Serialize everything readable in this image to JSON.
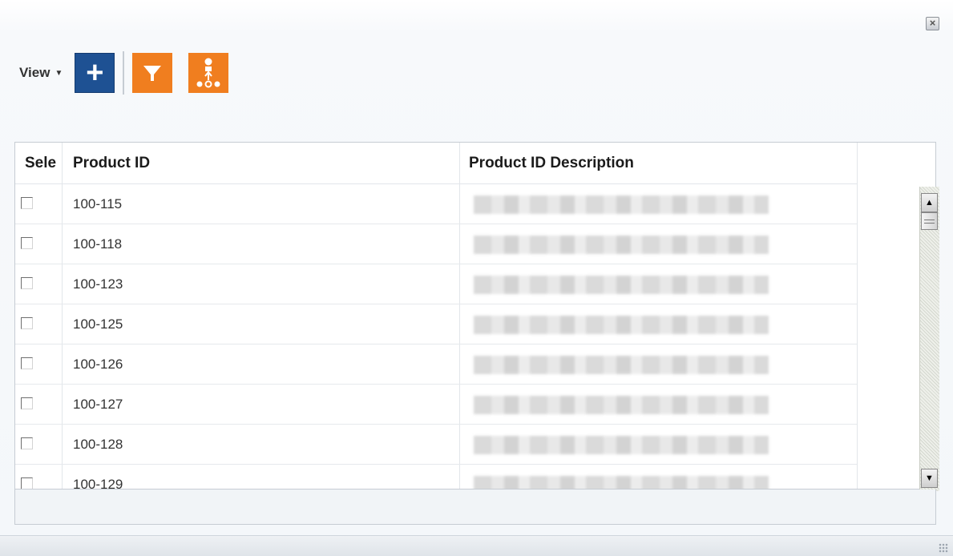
{
  "dialog": {
    "close_icon": "close-icon"
  },
  "toolbar": {
    "view_label": "View",
    "buttons": [
      {
        "name": "add",
        "icon": "plus-icon",
        "color": "#1e5193"
      },
      {
        "name": "filter",
        "icon": "filter-icon",
        "color": "#f07e1f"
      },
      {
        "name": "hierarchy",
        "icon": "hierarchy-icon",
        "color": "#f07e1f"
      }
    ]
  },
  "table": {
    "columns": [
      "Sele",
      "Product ID",
      "Product ID Description"
    ],
    "rows": [
      {
        "product_id": "100-115",
        "checked": false
      },
      {
        "product_id": "100-118",
        "checked": false
      },
      {
        "product_id": "100-123",
        "checked": false
      },
      {
        "product_id": "100-125",
        "checked": false
      },
      {
        "product_id": "100-126",
        "checked": false
      },
      {
        "product_id": "100-127",
        "checked": false
      },
      {
        "product_id": "100-128",
        "checked": false
      },
      {
        "product_id": "100-129",
        "checked": false
      }
    ]
  }
}
